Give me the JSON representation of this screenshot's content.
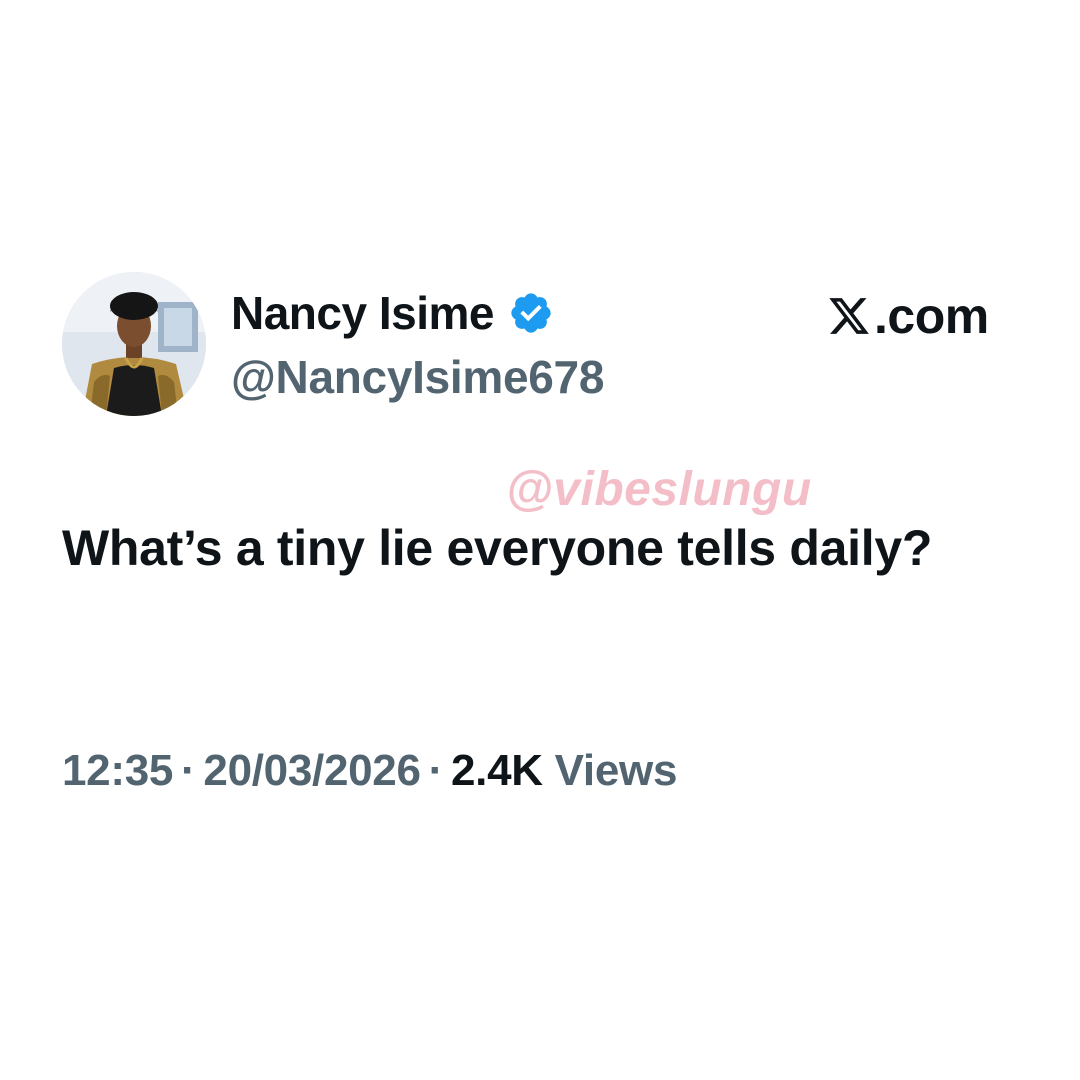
{
  "tweet": {
    "author": {
      "display_name": "Nancy Isime",
      "handle": "@NancyIsime678",
      "verified": true,
      "verified_icon": "verified-badge-icon",
      "avatar_icon": "profile-photo"
    },
    "brand": {
      "logo_icon": "x-logo-icon",
      "suffix": ".com"
    },
    "watermark": "@vibeslungu",
    "text": "What’s a tiny lie everyone tells daily?",
    "meta": {
      "time": "12:35",
      "separator": "·",
      "date": "20/03/2026",
      "views_count": "2.4K",
      "views_label": "Views"
    }
  },
  "colors": {
    "primary_text": "#0f1419",
    "secondary_text": "#536471",
    "verified_blue": "#1d9bf0",
    "watermark_pink": "#f2b3bf",
    "background": "#ffffff"
  }
}
